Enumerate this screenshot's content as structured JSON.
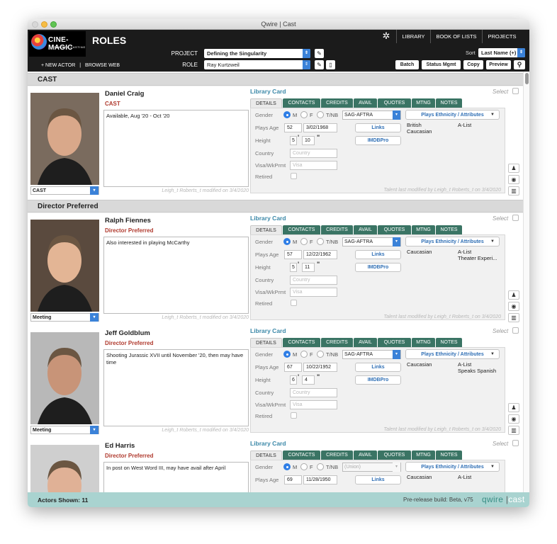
{
  "window": {
    "title": "Qwire | Cast"
  },
  "header": {
    "logo_title": "CINE-MAGIC",
    "logo_sub": "FEATURE CASTING",
    "page_title": "ROLES",
    "nav_tabs": [
      "LIBRARY",
      "BOOK OF LISTS",
      "PROJECTS"
    ],
    "project_label": "PROJECT",
    "project_value": "Defining the Singularity",
    "role_label": "ROLE",
    "role_value": "Ray Kurtzweil",
    "links": {
      "new_actor": "+ NEW ACTOR",
      "sep": "|",
      "browse_web": "BROWSE WEB"
    },
    "sort_label": "Sort",
    "sort_value": "Last Name (+)",
    "buttons": {
      "batch": "Batch",
      "status": "Status Mgmt",
      "copy": "Copy",
      "preview": "Preview"
    }
  },
  "labels": {
    "library_card": "Library Card",
    "select": "Select",
    "tabs": [
      "DETAILS",
      "CONTACTS",
      "CREDITS",
      "AVAIL",
      "QUOTES",
      "MTNG",
      "NOTES"
    ],
    "gender": "Gender",
    "m": "M",
    "f": "F",
    "tnb": "T/NB",
    "plays_age": "Plays Age",
    "height": "Height",
    "country": "Country",
    "visa": "Visa/WkPrmt",
    "retired": "Retired",
    "country_ph": "Country",
    "visa_ph": "Visa",
    "links_btn": "Links",
    "imdb_btn": "IMDBPro",
    "ethnicity_btn": "Plays Ethnicity / Attributes"
  },
  "sections": [
    {
      "title": "CAST"
    },
    {
      "title": "Director Preferred"
    }
  ],
  "actors": [
    {
      "name": "Daniel Craig",
      "role": "CAST",
      "status": "CAST",
      "note": "Available, Aug '20 - Oct '20",
      "modified": "Leigh_t Roberts_t modified on 3/4/2020",
      "union": "SAG-AFTRA",
      "age": "52",
      "dob": "3/02/1968",
      "ft": "5",
      "in": "10",
      "ethnicity": "British\nCaucasian",
      "attributes": "A-List",
      "talent_mod": "Talent last modified by Leigh_t Roberts_t on 3/4/2020"
    },
    {
      "name": "Ralph Fiennes",
      "role": "Director Preferred",
      "status": "Meeting",
      "note": "Also interested in playing McCarthy",
      "modified": "Leigh_t Roberts_t modified on 3/4/2020",
      "union": "SAG-AFTRA",
      "age": "57",
      "dob": "12/22/1962",
      "ft": "5",
      "in": "11",
      "ethnicity": "Caucasian",
      "attributes": "A-List\nTheater Experi...",
      "talent_mod": "Talent last modified by Leigh_t Roberts_t on 3/4/2020"
    },
    {
      "name": "Jeff Goldblum",
      "role": "Director Preferred",
      "status": "Meeting",
      "note": "Shooting Jurassic XVII until November '20, then may have time",
      "modified": "Leigh_t Roberts_t modified on 3/4/2020",
      "union": "SAG-AFTRA",
      "age": "67",
      "dob": "10/22/1952",
      "ft": "6",
      "in": "4",
      "ethnicity": "Caucasian",
      "attributes": "A-List\nSpeaks Spanish",
      "talent_mod": "Talent last modified by Leigh_t Roberts_t on 3/4/2020"
    },
    {
      "name": "Ed Harris",
      "role": "Director Preferred",
      "status": "",
      "note": "In post on West Word III, may have avail after April",
      "modified": "",
      "union": "(Union)",
      "age": "69",
      "dob": "11/28/1950",
      "ft": "",
      "in": "",
      "ethnicity": "Caucasian",
      "attributes": "A-List",
      "talent_mod": ""
    }
  ],
  "footer": {
    "shown": "Actors Shown: 11",
    "build": "Pre-release build: Beta, v75",
    "brand_a": "qwire",
    "brand_b": "cast"
  },
  "colors": {
    "header": "#1b1b1b",
    "tab_green": "#3a7464",
    "accent_blue": "#3b82d8",
    "role_red": "#b03a2e",
    "status_bar": "#a9d3d0"
  }
}
